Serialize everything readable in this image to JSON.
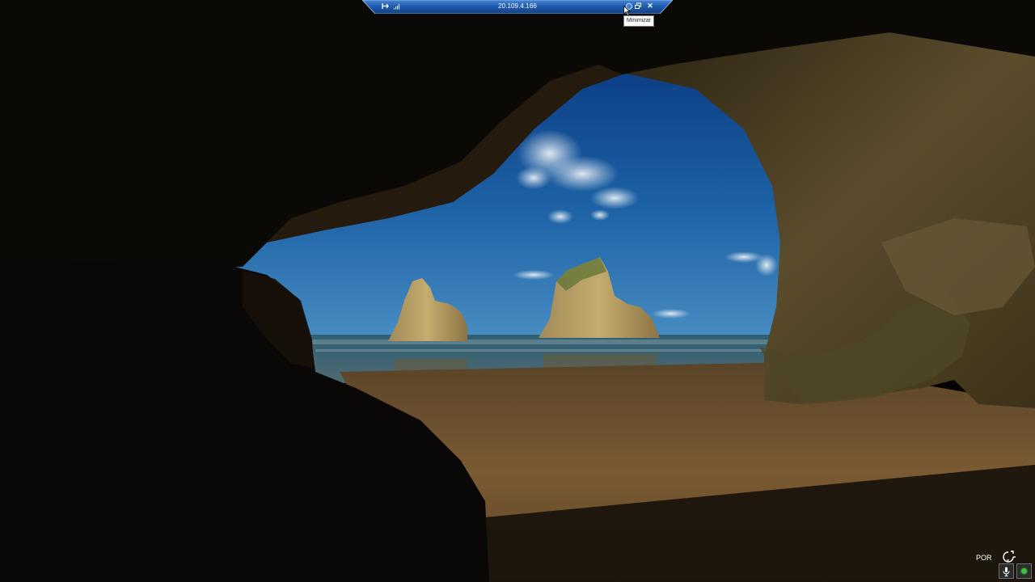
{
  "rdp_bar": {
    "host": "20.109.4.166",
    "pin_icon": "pin-icon",
    "signal_icon": "signal-bars-icon",
    "minimize_icon": "minimize-icon",
    "restore_icon": "restore-icon",
    "close_icon": "close-icon",
    "close_glyph": "✕",
    "bar_color": "#1b4f9c",
    "bar_highlight": "#4a86d6"
  },
  "tooltip": {
    "text": "Minimizar"
  },
  "lockscreen": {
    "language": "POR",
    "accessibility_icon": "accessibility-icon",
    "mic_icon": "microphone-icon",
    "status_icon": "status-dot-icon",
    "status_color": "#3ec43e"
  },
  "wallpaper": {
    "description_icon": "wallpaper-image"
  }
}
